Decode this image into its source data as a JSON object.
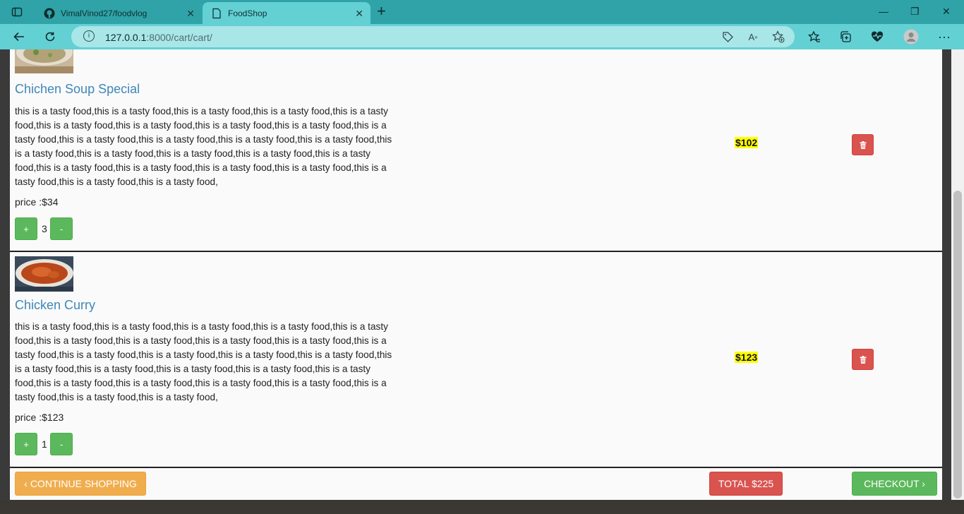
{
  "browser": {
    "tabs": [
      {
        "label": "VimalVinod27/foodvlog",
        "active": false
      },
      {
        "label": "FoodShop",
        "active": true
      }
    ],
    "url_host": "127.0.0.1",
    "url_path": ":8000/cart/cart/"
  },
  "cart": {
    "items": [
      {
        "name": "Chichen Soup Special",
        "description": "this is a tasty food,this is a tasty food,this is a tasty food,this is a tasty food,this is a tasty food,this is a tasty food,this is a tasty food,this is a tasty food,this is a tasty food,this is a tasty food,this is a tasty food,this is a tasty food,this is a tasty food,this is a tasty food,this is a tasty food,this is a tasty food,this is a tasty food,this is a tasty food,this is a tasty food,this is a tasty food,this is a tasty food,this is a tasty food,this is a tasty food,this is a tasty food,this is a tasty food,this is a tasty food,",
        "price_label": "price :$34",
        "plus": "+",
        "minus": "-",
        "quantity": "3",
        "subtotal": "$102"
      },
      {
        "name": "Chicken Curry",
        "description": "this is a tasty food,this is a tasty food,this is a tasty food,this is a tasty food,this is a tasty food,this is a tasty food,this is a tasty food,this is a tasty food,this is a tasty food,this is a tasty food,this is a tasty food,this is a tasty food,this is a tasty food,this is a tasty food,this is a tasty food,this is a tasty food,this is a tasty food,this is a tasty food,this is a tasty food,this is a tasty food,this is a tasty food,this is a tasty food,this is a tasty food,this is a tasty food,this is a tasty food,this is a tasty food,",
        "price_label": "price :$123",
        "plus": "+",
        "minus": "-",
        "quantity": "1",
        "subtotal": "$123"
      }
    ],
    "continue_label": "‹ CONTINUE SHOPPING",
    "total_label": "TOTAL $225",
    "checkout_label": "CHECKOUT ›"
  },
  "colors": {
    "tabbar": "#2fa3a8",
    "toolbar": "#63d0d4",
    "title_blue": "#3f87b9",
    "success": "#5cb85c",
    "danger": "#d9534f",
    "warning": "#f0ad4e",
    "highlight": "#ffff00"
  },
  "icons": [
    "sidebar-icon",
    "github-icon",
    "close-icon",
    "new-tab-icon",
    "minimize-icon",
    "restore-icon",
    "window-close-icon",
    "back-icon",
    "refresh-icon",
    "info-icon",
    "tag-icon",
    "read-aloud-icon",
    "add-favorite-icon",
    "favorites-icon",
    "collections-icon",
    "health-icon",
    "profile-icon",
    "more-icon",
    "trash-icon"
  ]
}
